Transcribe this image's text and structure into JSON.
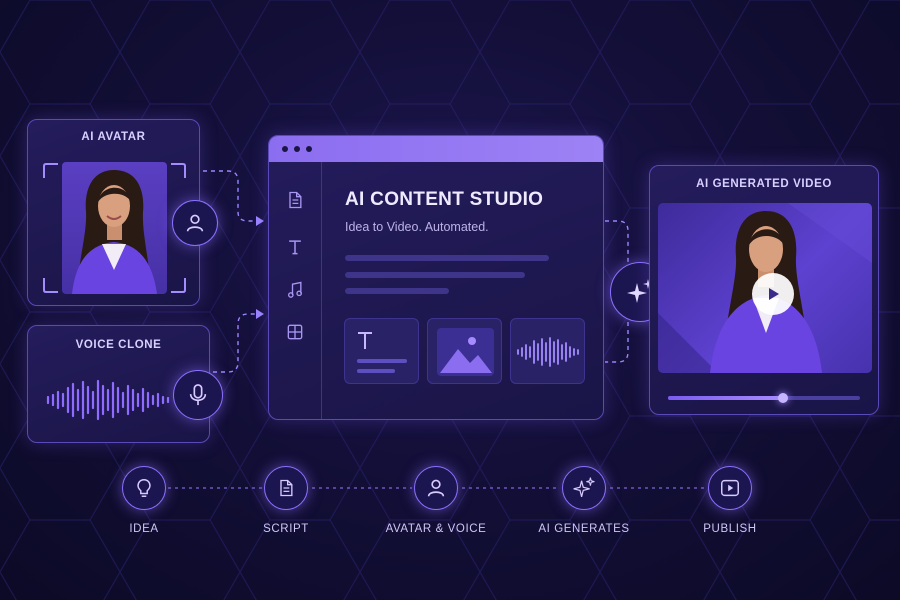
{
  "avatar_card": {
    "title": "AI AVATAR"
  },
  "voice_card": {
    "title": "VOICE CLONE"
  },
  "studio": {
    "title": "AI CONTENT STUDIO",
    "subtitle": "Idea to Video. Automated.",
    "sidebar_icons": [
      "document-icon",
      "text-icon",
      "music-icon",
      "layout-icon"
    ],
    "tiles": [
      "text-tile",
      "image-tile",
      "audio-tile"
    ]
  },
  "video_card": {
    "title": "AI GENERATED VIDEO",
    "progress": 0.6
  },
  "pipeline": {
    "steps": [
      {
        "label": "IDEA",
        "icon": "lightbulb-icon"
      },
      {
        "label": "SCRIPT",
        "icon": "document-icon"
      },
      {
        "label": "AVATAR & VOICE",
        "icon": "user-icon"
      },
      {
        "label": "AI GENERATES",
        "icon": "sparkles-icon"
      },
      {
        "label": "PUBLISH",
        "icon": "play-icon"
      }
    ]
  },
  "colors": {
    "accent": "#8b6df0",
    "background": "#130f38",
    "card": "#1f1850",
    "text": "#e9e4ff"
  }
}
